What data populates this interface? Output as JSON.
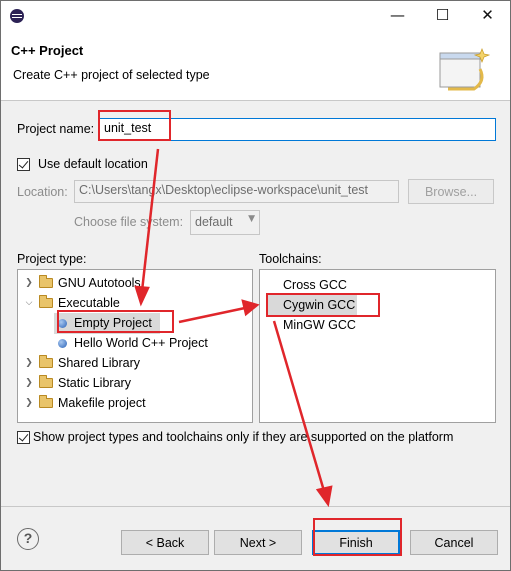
{
  "window": {
    "minimize_glyph": "—",
    "maximize_glyph": "☐",
    "close_glyph": "✕"
  },
  "header": {
    "title": "C++ Project",
    "description": "Create C++ project of selected type"
  },
  "form": {
    "project_name_label": "Project name:",
    "project_name_value": "unit_test",
    "use_default_location_label": "Use default location",
    "use_default_location_checked": true,
    "location_label": "Location:",
    "location_value": "C:\\Users\\tangx\\Desktop\\eclipse-workspace\\unit_test",
    "browse_label": "Browse...",
    "file_system_label": "Choose file system:",
    "file_system_value": "default"
  },
  "project_types": {
    "label": "Project type:",
    "items": [
      {
        "label": "GNU Autotools",
        "kind": "folder",
        "expanded": false,
        "level": 0
      },
      {
        "label": "Executable",
        "kind": "folder",
        "expanded": true,
        "level": 0
      },
      {
        "label": "Empty Project",
        "kind": "project",
        "level": 1,
        "selected": true
      },
      {
        "label": "Hello World C++ Project",
        "kind": "project",
        "level": 1
      },
      {
        "label": "Shared Library",
        "kind": "folder",
        "expanded": false,
        "level": 0
      },
      {
        "label": "Static Library",
        "kind": "folder",
        "expanded": false,
        "level": 0
      },
      {
        "label": "Makefile project",
        "kind": "folder",
        "expanded": false,
        "level": 0
      }
    ]
  },
  "toolchains": {
    "label": "Toolchains:",
    "items": [
      {
        "label": "Cross GCC"
      },
      {
        "label": "Cygwin GCC",
        "selected": true
      },
      {
        "label": "MinGW GCC"
      }
    ]
  },
  "filter": {
    "label": "Show project types and toolchains only if they are supported on the platform",
    "checked": true
  },
  "buttons": {
    "help": "?",
    "back": "< Back",
    "next": "Next >",
    "finish": "Finish",
    "cancel": "Cancel"
  },
  "colors": {
    "annotation_red": "#e0262b",
    "focus_blue": "#0078d7",
    "selection_gray": "#d9d9d9"
  }
}
